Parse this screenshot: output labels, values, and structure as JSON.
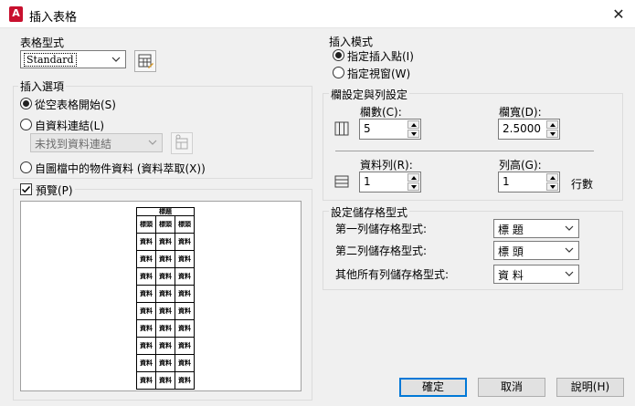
{
  "window": {
    "title": "插入表格",
    "icon_letter": "A"
  },
  "table_style": {
    "label": "表格型式",
    "selected": "Standard"
  },
  "insert_options": {
    "label": "插入選項",
    "from_empty": "從空表格開始(S)",
    "from_data_link": "自資料連結(L)",
    "data_link_placeholder": "未找到資料連結",
    "from_drawing_objects": "自圖檔中的物件資料 (資料萃取(X))"
  },
  "preview": {
    "label": "預覽(P)",
    "title_cell": "標題",
    "header_cells": [
      "標頭",
      "標頭",
      "標頭"
    ],
    "data_cell": "資料",
    "data_rows": 9
  },
  "insert_mode": {
    "label": "插入模式",
    "specify_point": "指定插入點(I)",
    "specify_window": "指定視窗(W)"
  },
  "column_row": {
    "label": "欄設定與列設定",
    "columns_label": "欄數(C):",
    "columns_value": "5",
    "column_width_label": "欄寬(D):",
    "column_width_value": "2.5000",
    "data_rows_label": "資料列(R):",
    "data_rows_value": "1",
    "row_height_label": "列高(G):",
    "row_height_value": "1",
    "row_height_unit": "行數"
  },
  "cell_styles": {
    "label": "設定儲存格型式",
    "first_row_label": "第一列儲存格型式:",
    "first_row_value": "標 題",
    "second_row_label": "第二列儲存格型式:",
    "second_row_value": "標 頭",
    "other_rows_label": "其他所有列儲存格型式:",
    "other_rows_value": "資 料"
  },
  "buttons": {
    "ok": "確定",
    "cancel": "取消",
    "help": "說明(H)"
  }
}
